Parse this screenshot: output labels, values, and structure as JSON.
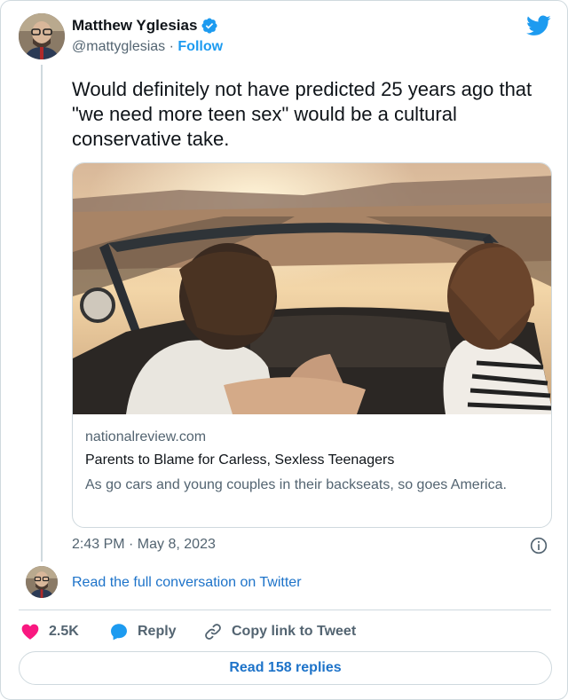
{
  "author": {
    "name": "Matthew Yglesias",
    "handle": "@mattyglesias",
    "separator": "·",
    "follow_label": "Follow"
  },
  "tweet": {
    "text": "Would definitely not have predicted 25 years ago that \"we need more teen sex\" would be a cultural conservative take.",
    "timestamp": "2:43 PM · May 8, 2023"
  },
  "link_card": {
    "domain": "nationalreview.com",
    "title": "Parents to Blame for Carless, Sexless Teenagers",
    "description": "As go cars and young couples in their backseats, so goes America."
  },
  "conversation": {
    "label": "Read the full conversation on Twitter"
  },
  "actions": {
    "like_count": "2.5K",
    "reply_label": "Reply",
    "copy_label": "Copy link to Tweet"
  },
  "replies": {
    "label": "Read 158 replies"
  },
  "colors": {
    "twitter_blue": "#1d9bf0",
    "link_blue": "#1d73c9",
    "like_pink": "#f91880",
    "muted_gray": "#536471"
  },
  "icons": [
    "verified-badge-icon",
    "twitter-bird-icon",
    "info-icon",
    "heart-icon",
    "reply-bubble-icon",
    "link-icon"
  ]
}
